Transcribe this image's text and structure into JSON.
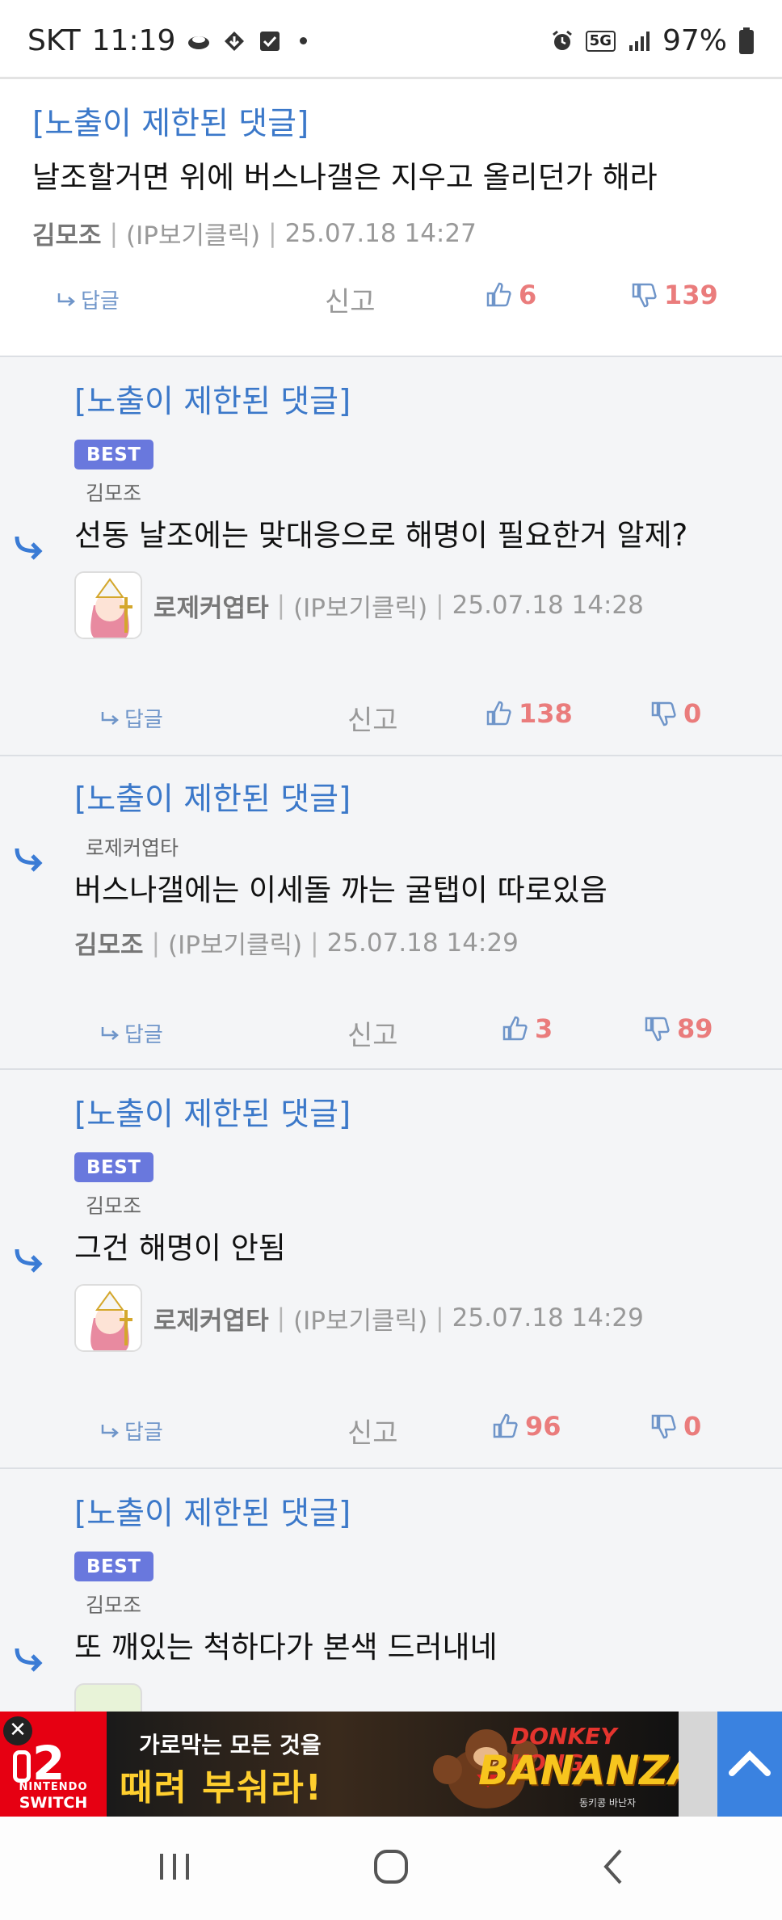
{
  "status_bar": {
    "carrier": "SKT",
    "time": "11:19",
    "network": "5G",
    "battery": "97%",
    "icons": [
      "weather-icon",
      "download-icon",
      "check-icon",
      "alarm-icon",
      "signal-icon",
      "battery-icon"
    ]
  },
  "comments": [
    {
      "type": "top",
      "restricted_label": "[노출이 제한된 댓글]",
      "text": "날조할거면 위에 버스나갤은 지우고 올리던가 해라",
      "author": "김모조",
      "ip": "(IP보기클릭)",
      "date": "25.07.18 14:27",
      "reply_label": "답글",
      "report_label": "신고",
      "up": "6",
      "down": "139"
    },
    {
      "type": "reply",
      "restricted_label": "[노출이 제한된 댓글]",
      "best": "BEST",
      "mention": "김모조",
      "text": "선동 날조에는 맞대응으로 해명이 필요한거 알제?",
      "author": "로제커엽타",
      "ip": "(IP보기클릭)",
      "date": "25.07.18 14:28",
      "reply_label": "답글",
      "report_label": "신고",
      "up": "138",
      "down": "0"
    },
    {
      "type": "reply",
      "restricted_label": "[노출이 제한된 댓글]",
      "mention": "로제커엽타",
      "text": "버스나갤에는 이세돌 까는 굴탭이 따로있음",
      "author": "김모조",
      "ip": "(IP보기클릭)",
      "date": "25.07.18 14:29",
      "reply_label": "답글",
      "report_label": "신고",
      "up": "3",
      "down": "89"
    },
    {
      "type": "reply",
      "restricted_label": "[노출이 제한된 댓글]",
      "best": "BEST",
      "mention": "김모조",
      "text": "그건 해명이 안됨",
      "author": "로제커엽타",
      "ip": "(IP보기클릭)",
      "date": "25.07.18 14:29",
      "reply_label": "답글",
      "report_label": "신고",
      "up": "96",
      "down": "0"
    },
    {
      "type": "reply",
      "restricted_label": "[노출이 제한된 댓글]",
      "best": "BEST",
      "mention": "김모조",
      "text": "또 깨있는 척하다가 본색 드러내네"
    }
  ],
  "ad": {
    "close": "✕",
    "switch_num": "2",
    "switch_brand": "NINTENDO",
    "switch_sub": "SWITCH",
    "line1": "가로막는 모든 것을",
    "line2": "때려 부숴라!",
    "logo1": "DONKEY KONG",
    "logo2": "BANANZA",
    "logo3": "동키콩 바난자"
  },
  "colors": {
    "accent_blue": "#3b78c9",
    "best_badge": "#6978dd",
    "vote_red": "#ea7c7c",
    "reply_bg": "#f4f5f7"
  }
}
